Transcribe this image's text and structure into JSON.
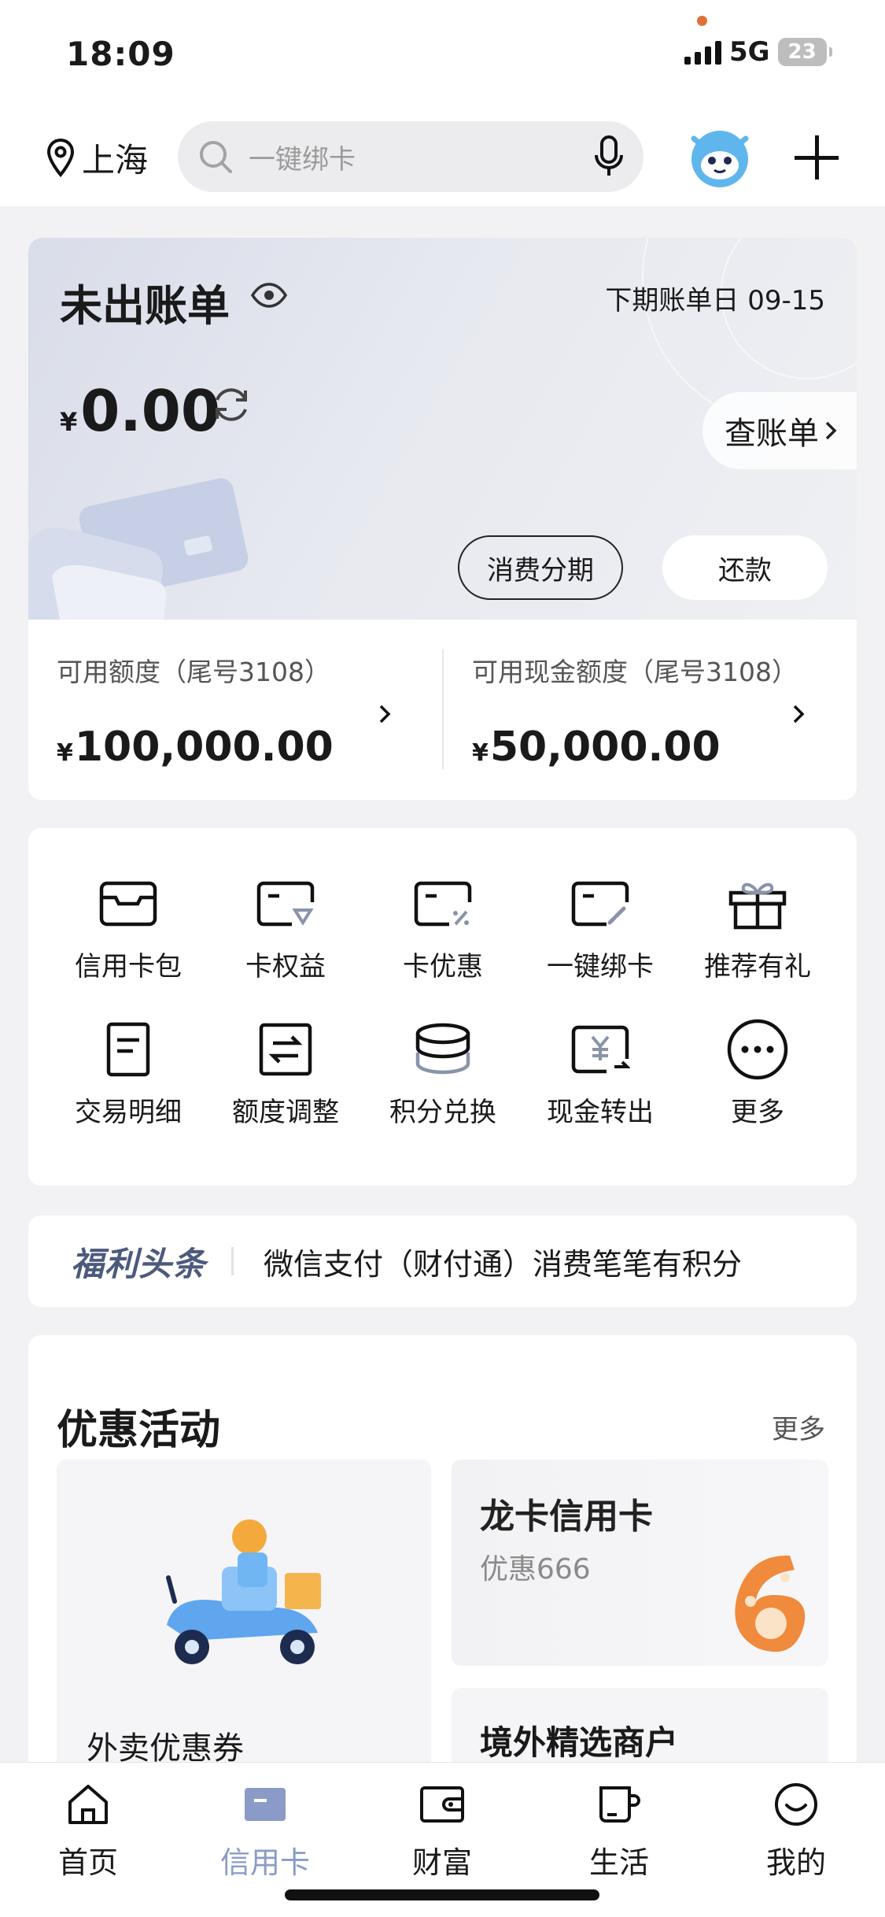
{
  "status_bar": {
    "time": "18:09",
    "network": "5G",
    "battery": "23"
  },
  "header": {
    "location": "上海",
    "search_placeholder": "一键绑卡"
  },
  "bill": {
    "title": "未出账单",
    "next_bill_date": "下期账单日 09-15",
    "currency": "¥",
    "amount": "0.00",
    "check_bill_label": "查账单",
    "installment_label": "消费分期",
    "repay_label": "还款"
  },
  "credit": {
    "available": {
      "label": "可用额度（尾号3108）",
      "currency": "¥",
      "amount": "100,000.00"
    },
    "cash": {
      "label": "可用现金额度（尾号3108）",
      "currency": "¥",
      "amount": "50,000.00"
    }
  },
  "grid": {
    "items": [
      {
        "label": "信用卡包",
        "icon": "card-wallet-icon"
      },
      {
        "label": "卡权益",
        "icon": "card-benefit-icon"
      },
      {
        "label": "卡优惠",
        "icon": "card-discount-icon"
      },
      {
        "label": "一键绑卡",
        "icon": "card-bind-icon"
      },
      {
        "label": "推荐有礼",
        "icon": "gift-icon"
      },
      {
        "label": "交易明细",
        "icon": "document-icon"
      },
      {
        "label": "额度调整",
        "icon": "adjust-icon"
      },
      {
        "label": "积分兑换",
        "icon": "coins-icon"
      },
      {
        "label": "现金转出",
        "icon": "cash-out-icon"
      },
      {
        "label": "更多",
        "icon": "more-icon"
      }
    ]
  },
  "news": {
    "tag": "福利头条",
    "text": "微信支付（财付通）消费笔笔有积分"
  },
  "promotions": {
    "title": "优惠活动",
    "more_label": "更多",
    "left_card": {
      "label": "外卖优惠券"
    },
    "right_top": {
      "title": "龙卡信用卡",
      "subtitle": "优惠666"
    },
    "right_bottom": {
      "title": "境外精选商户"
    }
  },
  "tabbar": {
    "items": [
      {
        "label": "首页",
        "icon": "home-icon"
      },
      {
        "label": "信用卡",
        "icon": "credit-card-icon"
      },
      {
        "label": "财富",
        "icon": "wallet-icon"
      },
      {
        "label": "生活",
        "icon": "cup-icon"
      },
      {
        "label": "我的",
        "icon": "smile-icon"
      }
    ],
    "active_color": "#8a9bc7"
  }
}
